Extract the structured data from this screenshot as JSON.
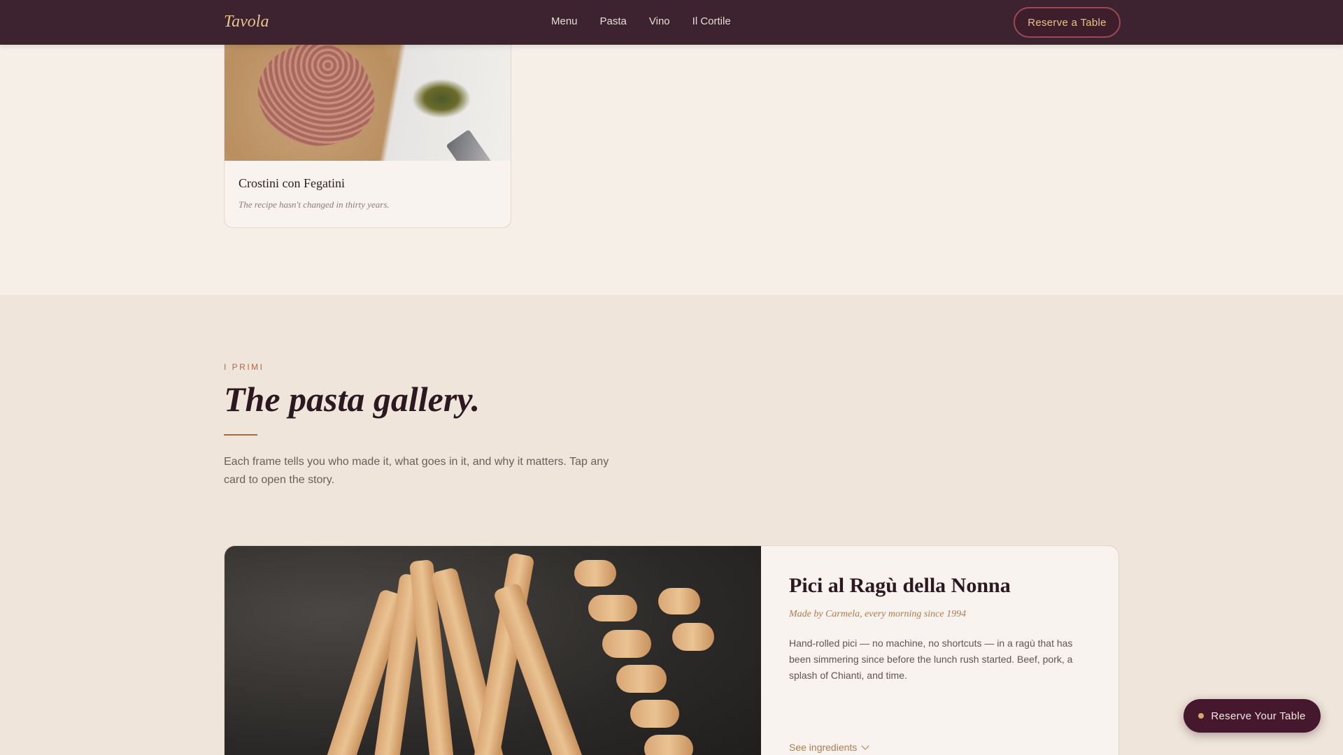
{
  "nav": {
    "brand": "Tavola",
    "links": [
      "Menu",
      "Pasta",
      "Vino",
      "Il Cortile"
    ],
    "cta": "Reserve a Table"
  },
  "antipasto_card": {
    "title": "Crostini con Fegatini",
    "subtitle": "The recipe hasn't changed in thirty years."
  },
  "pasta_section": {
    "eyebrow": "I PRIMI",
    "title": "The pasta gallery.",
    "intro": "Each frame tells you who made it, what goes in it, and why it matters. Tap any card to open the story."
  },
  "feature_card": {
    "title": "Pici al Ragù della Nonna",
    "maker": "Made by Carmela, every morning since 1994",
    "description": "Hand-rolled pici — no machine, no shortcuts — in a ragù that has been simmering since before the lunch rush started. Beef, pork, a splash of Chianti, and time.",
    "ingredients_toggle": "See ingredients"
  },
  "floating_cta": {
    "label": "Reserve Your Table"
  },
  "colors": {
    "nav_bg": "#3d2330",
    "accent_gold": "#e6c48b",
    "accent_copper": "#b4683c",
    "page_bg": "#f5efe8",
    "section_bg": "#efe5da",
    "cta_bg": "#45182d"
  },
  "icons": [
    "chevron-down-icon",
    "status-dot-icon"
  ]
}
